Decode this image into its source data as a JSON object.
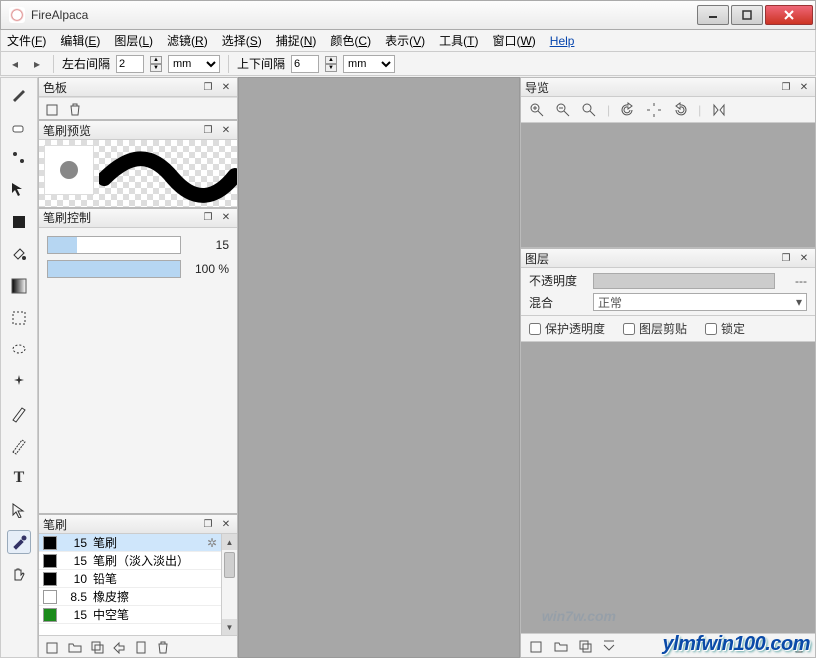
{
  "app_title": "FireAlpaca",
  "menus": [
    "文件(F)",
    "编辑(E)",
    "图层(L)",
    "滤镜(R)",
    "选择(S)",
    "捕捉(N)",
    "颜色(C)",
    "表示(V)",
    "工具(T)",
    "窗口(W)",
    "Help"
  ],
  "options": {
    "label_lr": "左右间隔",
    "val_lr": "2",
    "unit_lr": "mm",
    "label_tb": "上下间隔",
    "val_tb": "6",
    "unit_tb": "mm"
  },
  "panels": {
    "color": {
      "title": "色板"
    },
    "brush_preview": {
      "title": "笔刷预览"
    },
    "brush_control": {
      "title": "笔刷控制",
      "size_val": "15",
      "opacity_val": "100 %",
      "size_pct": 22,
      "opacity_pct": 100
    },
    "brush_list": {
      "title": "笔刷",
      "items": [
        {
          "sw": "#000",
          "size": "15",
          "name": "笔刷",
          "sel": true,
          "gear": true
        },
        {
          "sw": "#000",
          "size": "15",
          "name": "笔刷（淡入淡出）"
        },
        {
          "sw": "#000",
          "size": "10",
          "name": "铅笔"
        },
        {
          "sw": "#fff",
          "size": "8.5",
          "name": "橡皮擦"
        },
        {
          "sw": "#1a8a1a",
          "size": "15",
          "name": "中空笔"
        }
      ]
    },
    "navigator": {
      "title": "导览"
    },
    "layers": {
      "title": "图层",
      "opacity_label": "不透明度",
      "opacity_val": "---",
      "blend_label": "混合",
      "blend_val": "正常",
      "cb_protect": "保护透明度",
      "cb_clip": "图层剪贴",
      "cb_lock": "锁定"
    }
  },
  "watermark": "ylmfwin100.com",
  "watermark2": "win7w.com"
}
